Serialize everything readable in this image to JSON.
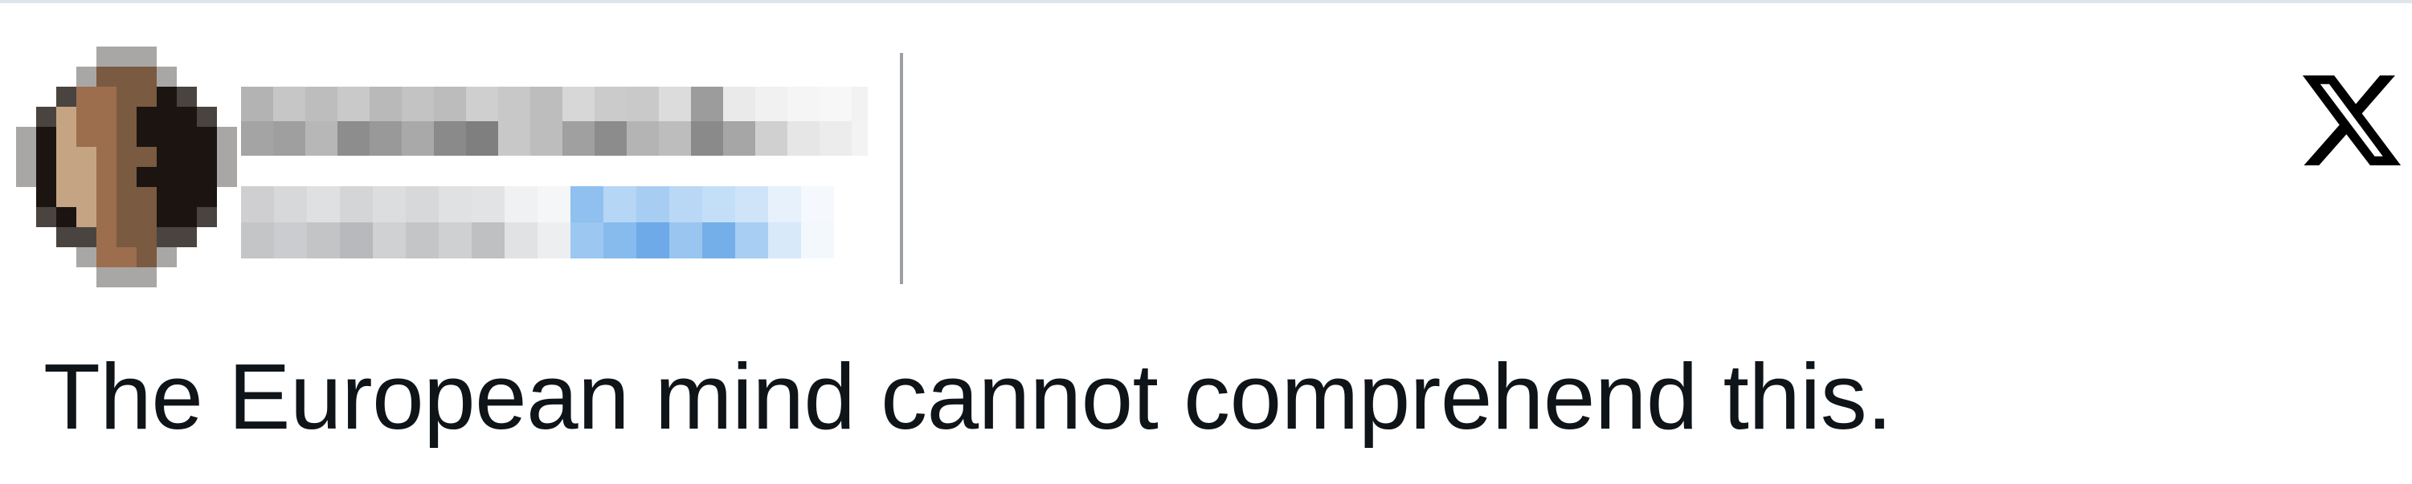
{
  "tweet": {
    "author": {
      "avatar": "pixelated-profile-photo",
      "name_redacted": true,
      "handle_redacted": true
    },
    "platform_icon": "x-logo-icon",
    "text": "The European mind cannot comprehend this."
  },
  "colors": {
    "text": "#0f1419",
    "border": "#dfe5ea",
    "redaction_gray": "#b0b3b8",
    "redaction_blue": "#8fc0ef"
  }
}
